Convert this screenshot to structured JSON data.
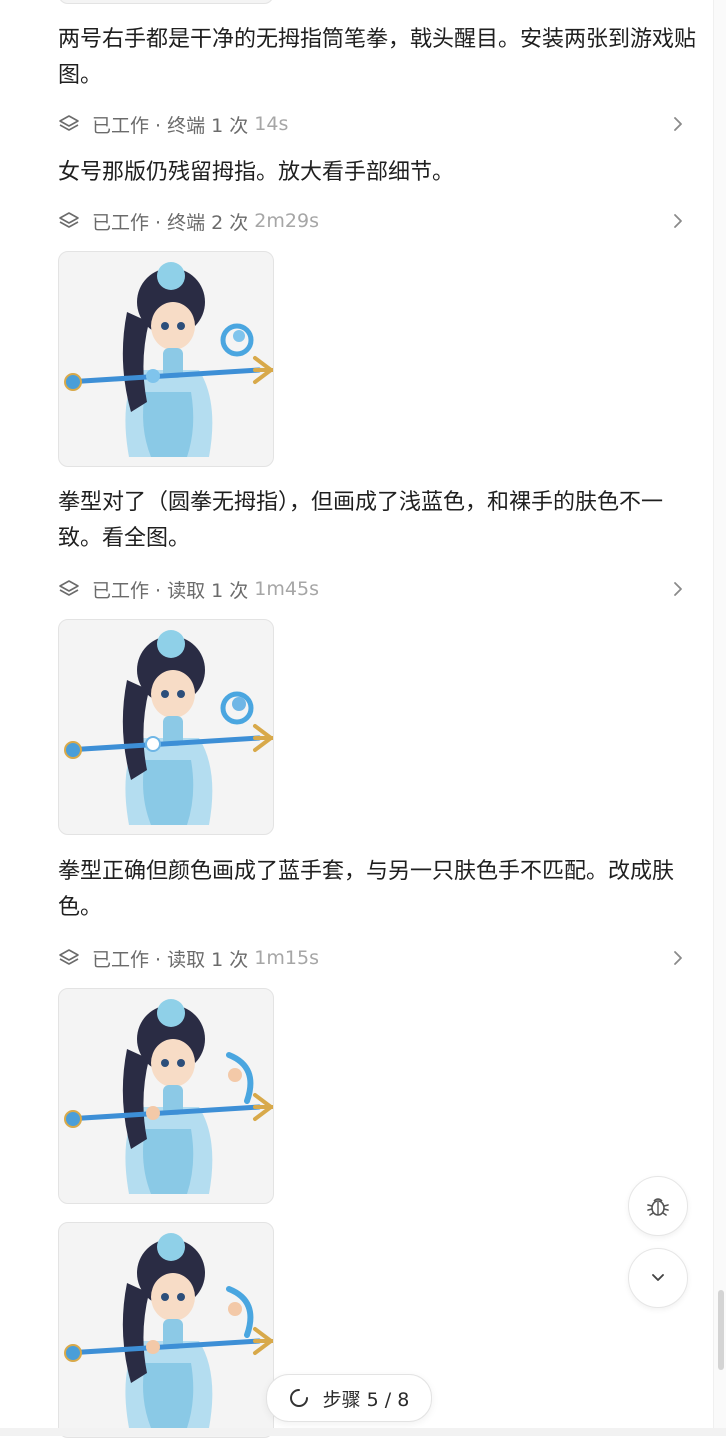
{
  "messages": [
    {
      "text": "两号右手都是干净的无拇指筒笔拳，戟头醒目。安装两张到游戏贴图。"
    },
    {
      "text": "女号那版仍残留拇指。放大看手部细节。"
    },
    {
      "text": "拳型对了（圆拳无拇指），但画成了浅蓝色，和裸手的肤色不一致。看全图。"
    },
    {
      "text": "拳型正确但颜色画成了蓝手套，与另一只肤色手不匹配。改成肤色。"
    }
  ],
  "work_items": [
    {
      "label": "已工作 · 终端 1 次",
      "time": "14s"
    },
    {
      "label": "已工作 · 终端 2 次",
      "time": "2m29s"
    },
    {
      "label": "已工作 · 读取 1 次",
      "time": "1m45s"
    },
    {
      "label": "已工作 · 读取 1 次",
      "time": "1m15s"
    }
  ],
  "thumbnails": [
    {
      "icon": "chibi-character-trident-image",
      "hand_color": "#7fc4ec"
    },
    {
      "icon": "chibi-character-trident-image",
      "hand_color": "#6fb6e6"
    },
    {
      "icon": "chibi-character-trident-image",
      "hand_color": "#f3c9a8"
    },
    {
      "icon": "chibi-character-trident-image",
      "hand_color": "#f3c9a8"
    }
  ],
  "step_indicator": {
    "label": "步骤 5 / 8"
  },
  "fabs": {
    "debug_icon": "bug-icon",
    "scroll_icon": "chevron-down-icon"
  },
  "colors": {
    "text": "#1f1f1f",
    "meta": "#6b6b6b",
    "time": "#a6a6a6",
    "border": "#e3e3e3",
    "accent": "#3d8fd6"
  }
}
